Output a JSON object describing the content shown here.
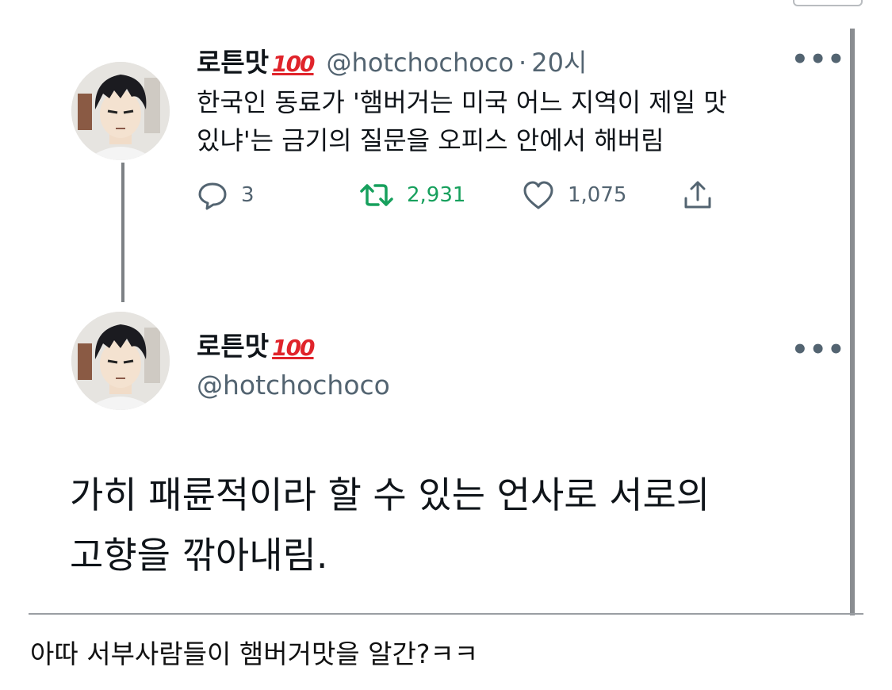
{
  "tweet1": {
    "name": "로튼맛",
    "badge": "100",
    "handle": "@hotchochoco",
    "separator": "·",
    "time": "20시",
    "more": "•••",
    "text_line1": "한국인 동료가 '햄버거는 미국 어느 지역이 제일 맛",
    "text_line2": "있냐'는 금기의 질문을 오피스 안에서 해버림",
    "replies": "3",
    "retweets": "2,931",
    "likes": "1,075",
    "icons": [
      "reply-icon",
      "retweet-icon",
      "like-icon",
      "share-icon"
    ],
    "retweet_color": "#17a05d"
  },
  "tweet2": {
    "name": "로튼맛",
    "badge": "100",
    "handle": "@hotchochoco",
    "more": "•••",
    "text_line1": "가히 패륜적이라 할 수 있는 언사로 서로의",
    "text_line2": "고향을 깎아내림."
  },
  "caption": "아따 서부사람들이 햄버거맛을 알간?ㅋㅋ"
}
